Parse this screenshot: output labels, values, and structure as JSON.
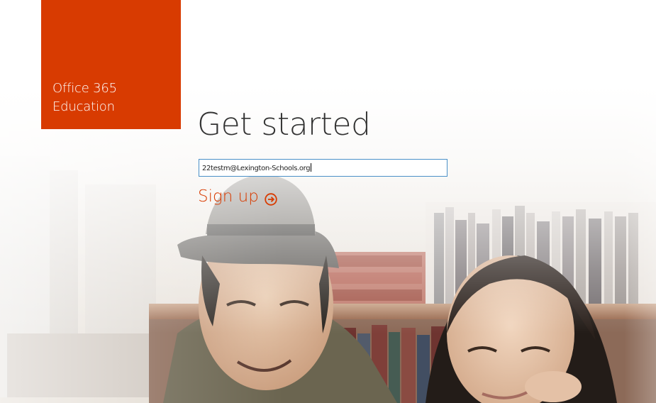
{
  "brand": {
    "line1": "Office 365",
    "line2": "Education",
    "color": "#d83b01"
  },
  "main": {
    "heading": "Get started",
    "email_value": "22testm@Lexington-Schools.org",
    "signup_label": "Sign up",
    "signup_icon": "circle-arrow-right-icon",
    "accent_color": "#d83b01"
  },
  "background": {
    "image_icon": "students-reading-photo"
  }
}
